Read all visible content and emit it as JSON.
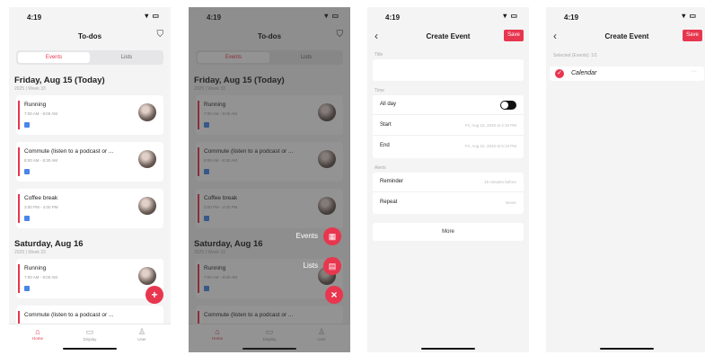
{
  "status": {
    "time": "4:19",
    "icons": "▾ ▭"
  },
  "screen1": {
    "title": "To-dos",
    "segments": [
      "Events",
      "Lists"
    ],
    "day1": {
      "header": "Friday, Aug 15 (Today)",
      "sub": "2025 | Week 33"
    },
    "day2": {
      "header": "Saturday, Aug 16",
      "sub": "2025 | Week 33"
    },
    "events": [
      {
        "title": "Running",
        "time": "7:00 AM - 8:00 AM"
      },
      {
        "title": "Commute (listen to a podcast or ...",
        "time": "8:00 AM - 8:30 AM"
      },
      {
        "title": "Coffee break",
        "time": "3:00 PM - 4:00 PM"
      },
      {
        "title": "Running",
        "time": "7:00 AM - 8:00 AM"
      },
      {
        "title": "Commute (listen to a podcast or ...",
        "time": ""
      }
    ],
    "fab": "+",
    "tabs": [
      {
        "icon": "⌂",
        "label": "Home"
      },
      {
        "icon": "▭",
        "label": "Display"
      },
      {
        "icon": "♙",
        "label": "User"
      }
    ]
  },
  "screen2": {
    "title": "To-dos",
    "segments": [
      "Events",
      "Lists"
    ],
    "day1": {
      "header": "Friday, Aug 15 (Today)",
      "sub": "2025 | Week 33"
    },
    "day2": {
      "header": "Saturday, Aug 16",
      "sub": "2025 | Week 33"
    },
    "events": [
      {
        "title": "Running",
        "time": "7:00 AM - 8:00 AM"
      },
      {
        "title": "Commute (listen to a podcast or ...",
        "time": "8:00 AM - 8:30 AM"
      },
      {
        "title": "Coffee break",
        "time": "3:00 PM - 4:00 PM"
      },
      {
        "title": "Running",
        "time": "7:00 AM - 8:00 AM"
      },
      {
        "title": "Commute (listen to a podcast or ...",
        "time": ""
      }
    ],
    "menu": [
      {
        "label": "Events",
        "icon": "▦"
      },
      {
        "label": "Lists",
        "icon": "▤"
      }
    ],
    "close": "×"
  },
  "screen3": {
    "title": "Create Event",
    "save": "Save",
    "title_section": "Title",
    "time_section": "Time",
    "all_day": "All day",
    "start_label": "Start",
    "start_value": "Fri, Aug 15, 2025 at 4:19 PM",
    "end_label": "End",
    "end_value": "Fri, Aug 15, 2025 at 5:19 PM",
    "alerts_section": "Alerts",
    "reminder_label": "Reminder",
    "reminder_value": "15 minutes before",
    "repeat_label": "Repeat",
    "repeat_value": "Never",
    "more": "More"
  },
  "screen4": {
    "title": "Create Event",
    "save": "Save",
    "selected": "Selected (Events): 1/1",
    "calendar": "Calendar",
    "dots": "···"
  }
}
